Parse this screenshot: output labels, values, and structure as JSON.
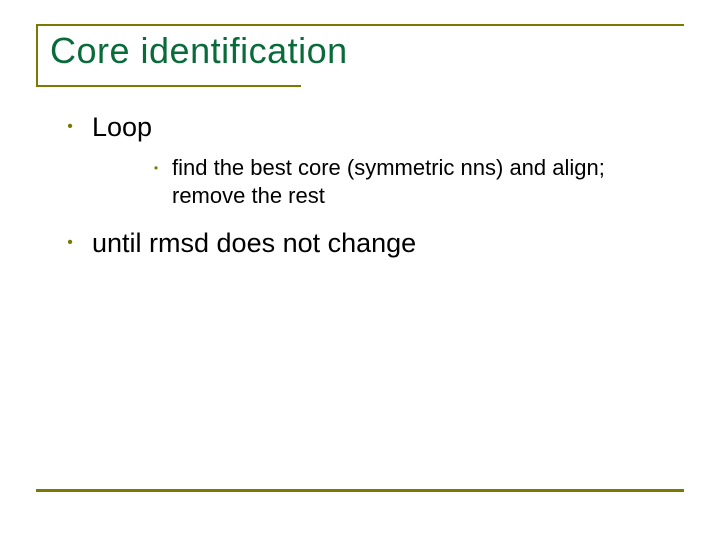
{
  "title": "Core identification",
  "bullets": {
    "loop": "Loop",
    "sub1": "find the best core (symmetric nns) and align; remove the rest",
    "until": "until rmsd does not change"
  },
  "colors": {
    "accent": "#7a7a00",
    "title": "#0a6b3a"
  }
}
